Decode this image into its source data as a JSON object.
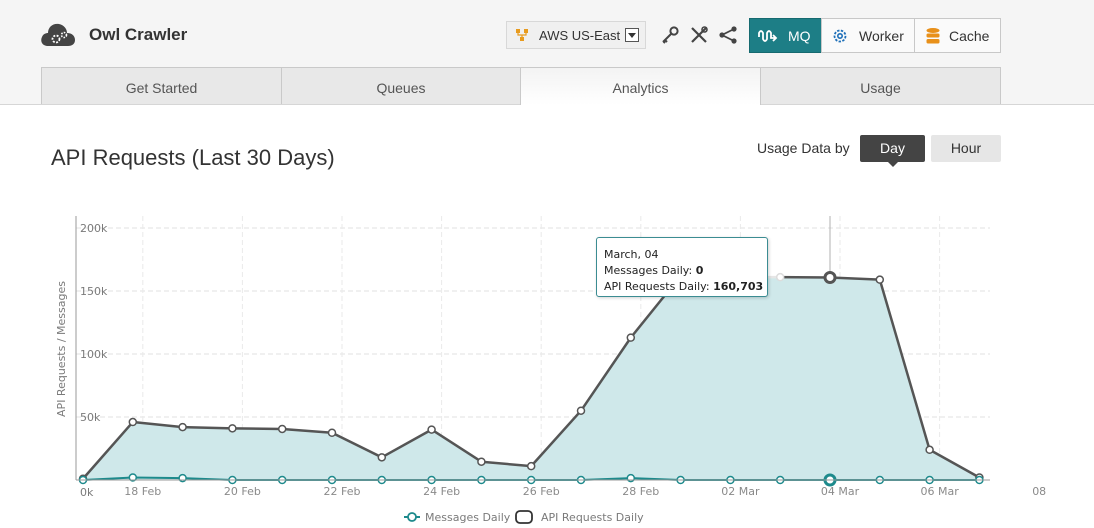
{
  "app": {
    "title": "Owl Crawler"
  },
  "region": {
    "label": "AWS US-East"
  },
  "toolbar": {
    "tool_icons": [
      "key-icon",
      "tools-icon",
      "share-icon"
    ],
    "services": [
      {
        "label": "MQ",
        "icon": "mq-wave-icon",
        "active": true
      },
      {
        "label": "Worker",
        "icon": "gear-icon",
        "active": false
      },
      {
        "label": "Cache",
        "icon": "database-icon",
        "active": false
      }
    ]
  },
  "tabs": [
    {
      "label": "Get Started",
      "active": false
    },
    {
      "label": "Queues",
      "active": false
    },
    {
      "label": "Analytics",
      "active": true
    },
    {
      "label": "Usage",
      "active": false
    }
  ],
  "page": {
    "title": "API Requests (Last 30 Days)",
    "usage_label": "Usage Data by",
    "toggle": {
      "day": "Day",
      "hour": "Hour",
      "selected": "Day"
    }
  },
  "colors": {
    "accent": "#1d7e86",
    "api_line": "#555555",
    "api_fill": "#cfe8ea",
    "messages_line": "#1d8a8c"
  },
  "chart_data": {
    "type": "area",
    "ylabel": "API Requests / Messages",
    "ylim": [
      0,
      200000
    ],
    "y_ticks": [
      0,
      50000,
      100000,
      150000,
      200000
    ],
    "y_tick_labels": [
      "0k",
      "50k",
      "100k",
      "150k",
      "200k"
    ],
    "x_tick_labels": [
      "18 Feb",
      "20 Feb",
      "22 Feb",
      "24 Feb",
      "26 Feb",
      "28 Feb",
      "02 Mar",
      "04 Mar",
      "06 Mar",
      "08"
    ],
    "x": [
      "Feb 17",
      "Feb 18",
      "Feb 19",
      "Feb 20",
      "Feb 21",
      "Feb 22",
      "Feb 23",
      "Feb 24",
      "Feb 25",
      "Feb 26",
      "Feb 27",
      "Feb 28",
      "Mar 01",
      "Mar 02",
      "Mar 03",
      "Mar 04",
      "Mar 05",
      "Mar 06",
      "Mar 07"
    ],
    "series": [
      {
        "name": "API Requests Daily",
        "values": [
          1000,
          46000,
          42000,
          41000,
          40500,
          37500,
          18000,
          40000,
          14500,
          11000,
          55000,
          113000,
          162000,
          161000,
          161000,
          160703,
          159000,
          24000,
          2000
        ]
      },
      {
        "name": "Messages Daily",
        "values": [
          0,
          2000,
          1500,
          0,
          0,
          0,
          0,
          0,
          0,
          0,
          0,
          1500,
          0,
          0,
          0,
          0,
          0,
          0,
          0
        ]
      }
    ],
    "legend_position": "bottom-center",
    "grid": true,
    "highlight_index": 15,
    "tooltip": {
      "date": "March, 04",
      "messages_label": "Messages Daily:",
      "messages_value": "0",
      "api_label": "API Requests Daily:",
      "api_value": "160,703"
    }
  }
}
